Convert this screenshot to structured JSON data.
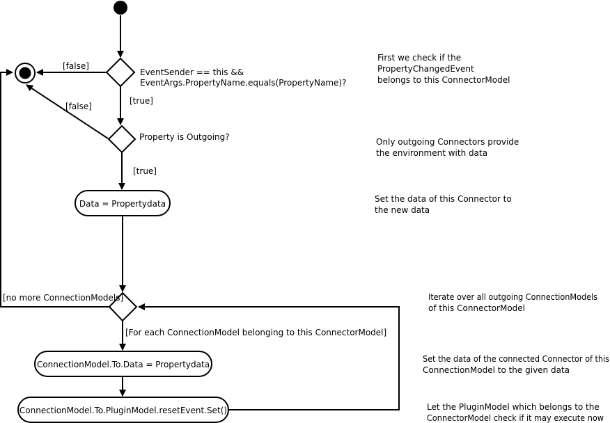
{
  "diagram": {
    "conditions": {
      "check_sender_line1": "EventSender == this &&",
      "check_sender_line2": "EventArgs.PropertyName.equals(PropertyName)?",
      "is_outgoing": "Property is Outgoing?"
    },
    "actions": {
      "set_data": "Data = Propertydata",
      "set_connection_data": "ConnectionModel.To.Data = Propertydata",
      "reset_event": "ConnectionModel.To.PluginModel.resetEvent.Set()"
    },
    "guards": {
      "false_1": "[false]",
      "false_2": "[false]",
      "true_1": "[true]",
      "true_2": "[true]",
      "no_more": "[no more ConnectionModels]",
      "for_each": "[For each ConnectionModel belonging to this ConnectorModel]"
    },
    "notes": {
      "note1": [
        "First we check if the",
        "PropertyChangedEvent",
        "belongs to this ConnectorModel"
      ],
      "note2": [
        "Only outgoing Connectors provide",
        "the environment with data"
      ],
      "note3": [
        "Set the data of this Connector to",
        "the new data"
      ],
      "note4": [
        "Iterate over all outgoing ConnectionModels",
        "of this ConnectorModel"
      ],
      "note5": [
        "Set the data of the connected Connector of this",
        "ConnectionModel to the given data"
      ],
      "note6": [
        "Let the PluginModel which belongs to the",
        "ConnectorModel check if it may execute now"
      ]
    }
  }
}
